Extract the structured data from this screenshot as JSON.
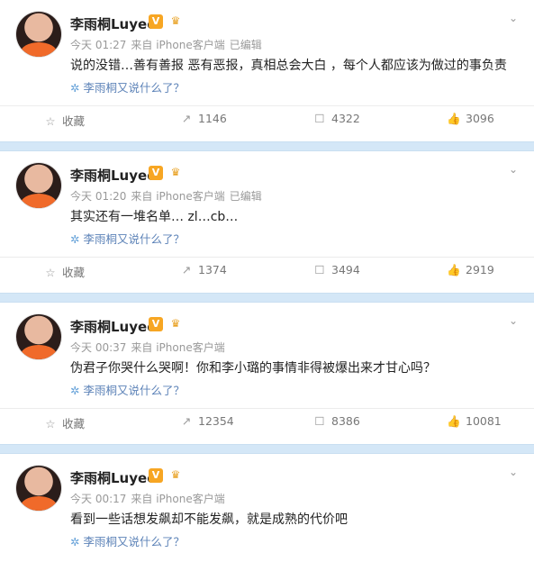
{
  "colors": {
    "separator": "#d4e7f7",
    "link": "#5d83b8",
    "meta": "#999999",
    "badge": "#f7a623"
  },
  "icons": {
    "vip": "v-badge-icon",
    "crown": "crown-icon",
    "more": "chevron-down-icon",
    "star": "star-icon",
    "repost": "repost-icon",
    "comment": "comment-icon",
    "like": "thumb-up-icon",
    "sparkle": "sparkle-icon"
  },
  "posts": [
    {
      "username": "李雨桐Luyee",
      "time": "今天 01:27",
      "source": "来自 iPhone客户端",
      "edited": "已编辑",
      "text": "说的没错…善有善报 恶有恶报，真相总会大白 ，每个人都应该为做过的事负责",
      "view_link": "李雨桐又说什么了？",
      "fav_label": "收藏",
      "reposts": "1146",
      "comments": "4322",
      "likes": "3096"
    },
    {
      "username": "李雨桐Luyee",
      "time": "今天 01:20",
      "source": "来自 iPhone客户端",
      "edited": "已编辑",
      "text": "其实还有一堆名单… zl…cb…",
      "view_link": "李雨桐又说什么了？",
      "fav_label": "收藏",
      "reposts": "1374",
      "comments": "3494",
      "likes": "2919"
    },
    {
      "username": "李雨桐Luyee",
      "time": "今天 00:37",
      "source": "来自 iPhone客户端",
      "edited": "",
      "text": "伪君子你哭什么哭啊！你和李小璐的事情非得被爆出来才甘心吗？",
      "view_link": "李雨桐又说什么了？",
      "fav_label": "收藏",
      "reposts": "12354",
      "comments": "8386",
      "likes": "10081"
    },
    {
      "username": "李雨桐Luyee",
      "time": "今天 00:17",
      "source": "来自 iPhone客户端",
      "edited": "",
      "text": "看到一些话想发飙却不能发飙，就是成熟的代价吧",
      "view_link": "李雨桐又说什么了？"
    }
  ]
}
